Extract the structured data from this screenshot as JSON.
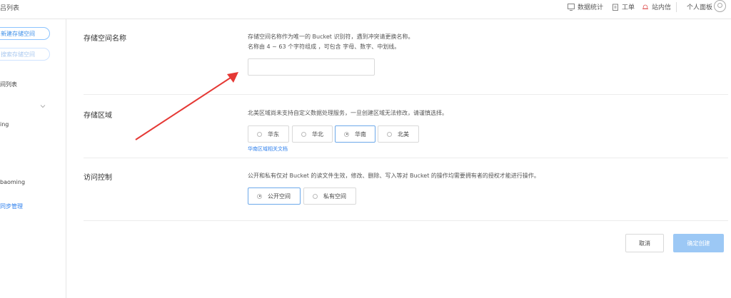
{
  "header": {
    "breadcrumb": "吕列表",
    "nav": [
      {
        "label": "数据统计",
        "icon": "chart-icon"
      },
      {
        "label": "工单",
        "icon": "clipboard-icon"
      },
      {
        "label": "站内信",
        "icon": "bell-icon"
      }
    ],
    "user_label": "个人面板"
  },
  "sidebar": {
    "create_button": "新建存储空间",
    "search_placeholder": "搜索存储空间",
    "items": [
      "间列表",
      "ing",
      "baoming",
      "同步管理"
    ]
  },
  "form": {
    "name": {
      "label": "存储空间名称",
      "help1": "存储空间名称作为唯一的 Bucket 识别符，遇到冲突请更换名称。",
      "help2": "名称由 4 ~ 63 个字符组成 ，可包含 字母、数字、中划线。",
      "value": ""
    },
    "region": {
      "label": "存储区域",
      "help": "北美区域尚未支持自定义数据处理服务，一旦创建区域无法修改，请谨慎选择。",
      "options": [
        "华东",
        "华北",
        "华南",
        "北美"
      ],
      "selected": "华南",
      "doc_link": "华南区域相关文档"
    },
    "access": {
      "label": "访问控制",
      "help": "公开和私有仅对 Bucket 的读文件生效，修改、删除、写入等对 Bucket 的操作均需要拥有者的授权才能进行操作。",
      "options": [
        "公开空间",
        "私有空间"
      ],
      "selected": "公开空间"
    }
  },
  "actions": {
    "cancel": "取消",
    "confirm": "确定创建"
  },
  "colors": {
    "accent": "#2f80ed",
    "confirm_disabled": "#9cc8f5",
    "annotation_arrow": "#e53935"
  }
}
